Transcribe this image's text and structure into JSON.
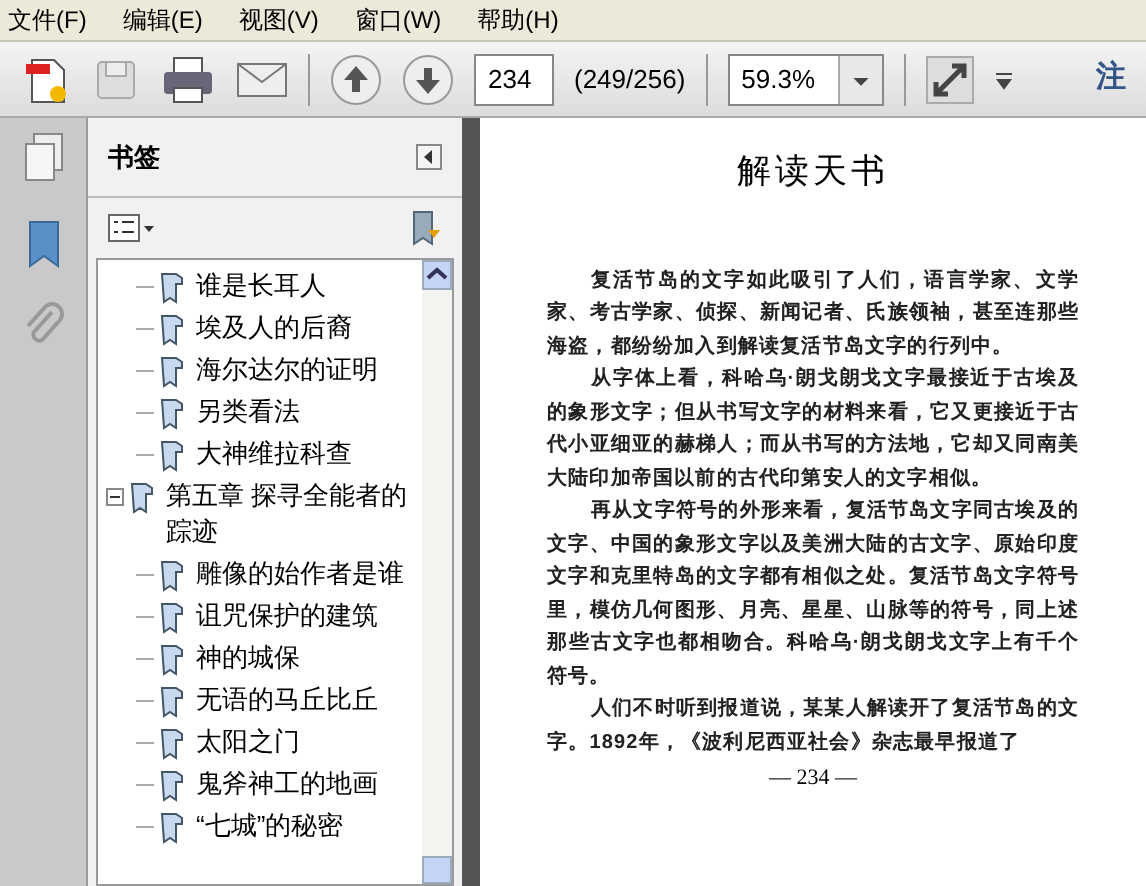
{
  "menu": [
    "文件(F)",
    "编辑(E)",
    "视图(V)",
    "窗口(W)",
    "帮助(H)"
  ],
  "toolbar": {
    "page_number": "234",
    "page_count": "(249/256)",
    "zoom": "59.3%",
    "cut_label": "注"
  },
  "panel": {
    "title": "书签"
  },
  "bookmarks": [
    {
      "label": "谁是长耳人"
    },
    {
      "label": "埃及人的后裔"
    },
    {
      "label": "海尔达尔的证明"
    },
    {
      "label": "另类看法"
    },
    {
      "label": "大神维拉科查"
    },
    {
      "label": "第五章 探寻全能者的踪迹",
      "expanded": true,
      "children": [
        {
          "label": "雕像的始作者是谁"
        },
        {
          "label": "诅咒保护的建筑"
        },
        {
          "label": "神的城保"
        },
        {
          "label": "无语的马丘比丘"
        },
        {
          "label": "太阳之门"
        },
        {
          "label": "鬼斧神工的地画"
        },
        {
          "label": "“七城”的秘密"
        }
      ]
    }
  ],
  "document": {
    "title": "解读天书",
    "paragraphs": [
      "复活节岛的文字如此吸引了人们，语言学家、文学家、考古学家、侦探、新闻记者、氏族领袖，甚至连那些海盗，都纷纷加入到解读复活节岛文字的行列中。",
      "从字体上看，科哈乌·朗戈朗戈文字最接近于古埃及的象形文字；但从书写文字的材料来看，它又更接近于古代小亚细亚的赫梯人；而从书写的方法地，它却又同南美大陆印加帝国以前的古代印第安人的文字相似。",
      "再从文字符号的外形来看，复活节岛文字同古埃及的文字、中国的象形文字以及美洲大陆的古文字、原始印度文字和克里特岛的文字都有相似之处。复活节岛文字符号里，模仿几何图形、月亮、星星、山脉等的符号，同上述那些古文字也都相吻合。科哈乌·朗戈朗戈文字上有千个符号。",
      "人们不时听到报道说，某某人解读开了复活节岛的文字。1892年，《波利尼西亚社会》杂志最早报道了"
    ],
    "footer": "— 234 —"
  }
}
